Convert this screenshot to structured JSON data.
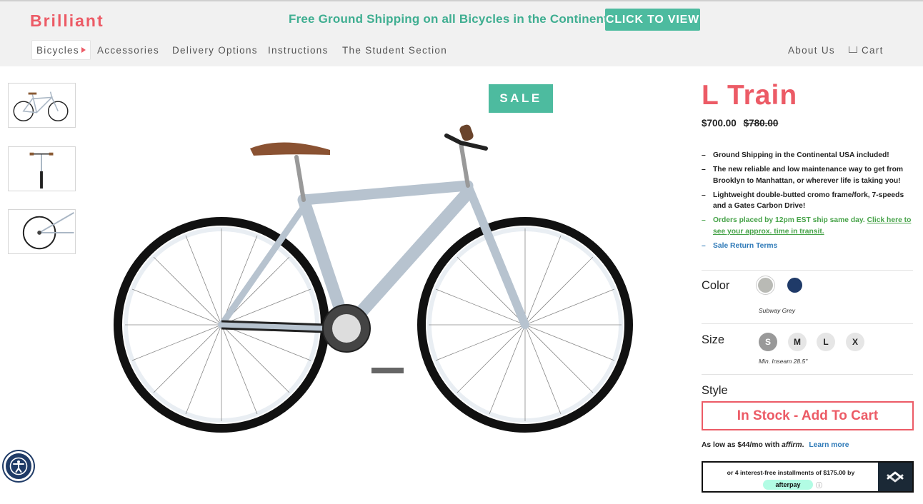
{
  "brand": {
    "logo": "Brilliant"
  },
  "promo": {
    "text": "Free Ground Shipping on all Bicycles in the Continental USA!",
    "cta": "CLICK TO VIEW"
  },
  "nav": {
    "left": [
      "Bicycles",
      "Accessories",
      "Delivery Options",
      "Instructions",
      "The Student Section"
    ],
    "about": "About Us",
    "cart": "Cart"
  },
  "gallery": {
    "thumbnails": [
      "bike-side-view",
      "bike-front-view",
      "bike-rear-detail"
    ],
    "badge": "SALE"
  },
  "product": {
    "title": "L Train",
    "price": "$700.00",
    "old_price": "$780.00",
    "bullets": [
      "Ground Shipping in the Continental USA included!",
      "The new reliable and low maintenance way to get from Brooklyn to Manhattan, or wherever life is taking you!",
      "Lightweight double-butted cromo frame/fork, 7-speeds and a Gates Carbon Drive!"
    ],
    "ship_note": "Orders placed by 12pm EST ship same day.",
    "ship_link": "Click here to see your approx. time in transit.",
    "return_terms": "Sale Return Terms"
  },
  "options": {
    "color_label": "Color",
    "colors": [
      {
        "name": "Subway Grey",
        "hex": "#b9bab5"
      },
      {
        "name": "navy",
        "hex": "#1f3a68"
      }
    ],
    "selected_color": "Subway Grey",
    "size_label": "Size",
    "sizes": [
      "S",
      "M",
      "L",
      "X"
    ],
    "size_note": "Min. Inseam 28.5\"",
    "style_label": "Style"
  },
  "actions": {
    "add_to_cart": "In Stock - Add To Cart"
  },
  "financing": {
    "affirm_prefix": "As low as $44/mo with",
    "affirm_logo": "affirm",
    "learn_more": "Learn more",
    "afterpay_text": "or 4 interest-free installments of $175.00 by",
    "afterpay_logo": "afterpay",
    "info": "ⓘ"
  },
  "colors": {
    "accent": "#ec5b66",
    "teal": "#4dbb9f",
    "link_blue": "#2f7ab8",
    "green": "#47a349"
  }
}
